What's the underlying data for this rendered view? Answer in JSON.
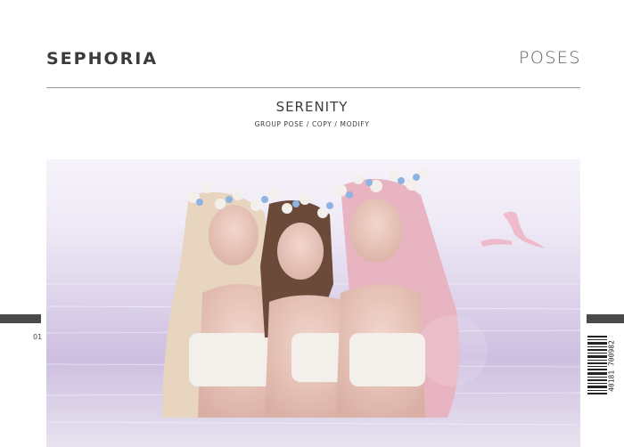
{
  "header": {
    "brand": "SEPHORIA",
    "section": "POSES"
  },
  "product": {
    "title": "SERENITY",
    "subtitle": "GROUP POSE / COPY / MODIFY"
  },
  "page": {
    "number": "01"
  },
  "barcode": {
    "digits": "40181 700982"
  },
  "image": {
    "description_icon": "photo",
    "colors": {
      "sky": "#f3eff8",
      "water": "#cfc1e0",
      "crown_blue": "#8fb3e0",
      "crown_white": "#f4f1ee",
      "hair_blonde": "#e7d3bd",
      "hair_brown": "#6b4a3a",
      "hair_pink": "#e9b4c2",
      "flamingo": "#f0b9c6"
    }
  }
}
